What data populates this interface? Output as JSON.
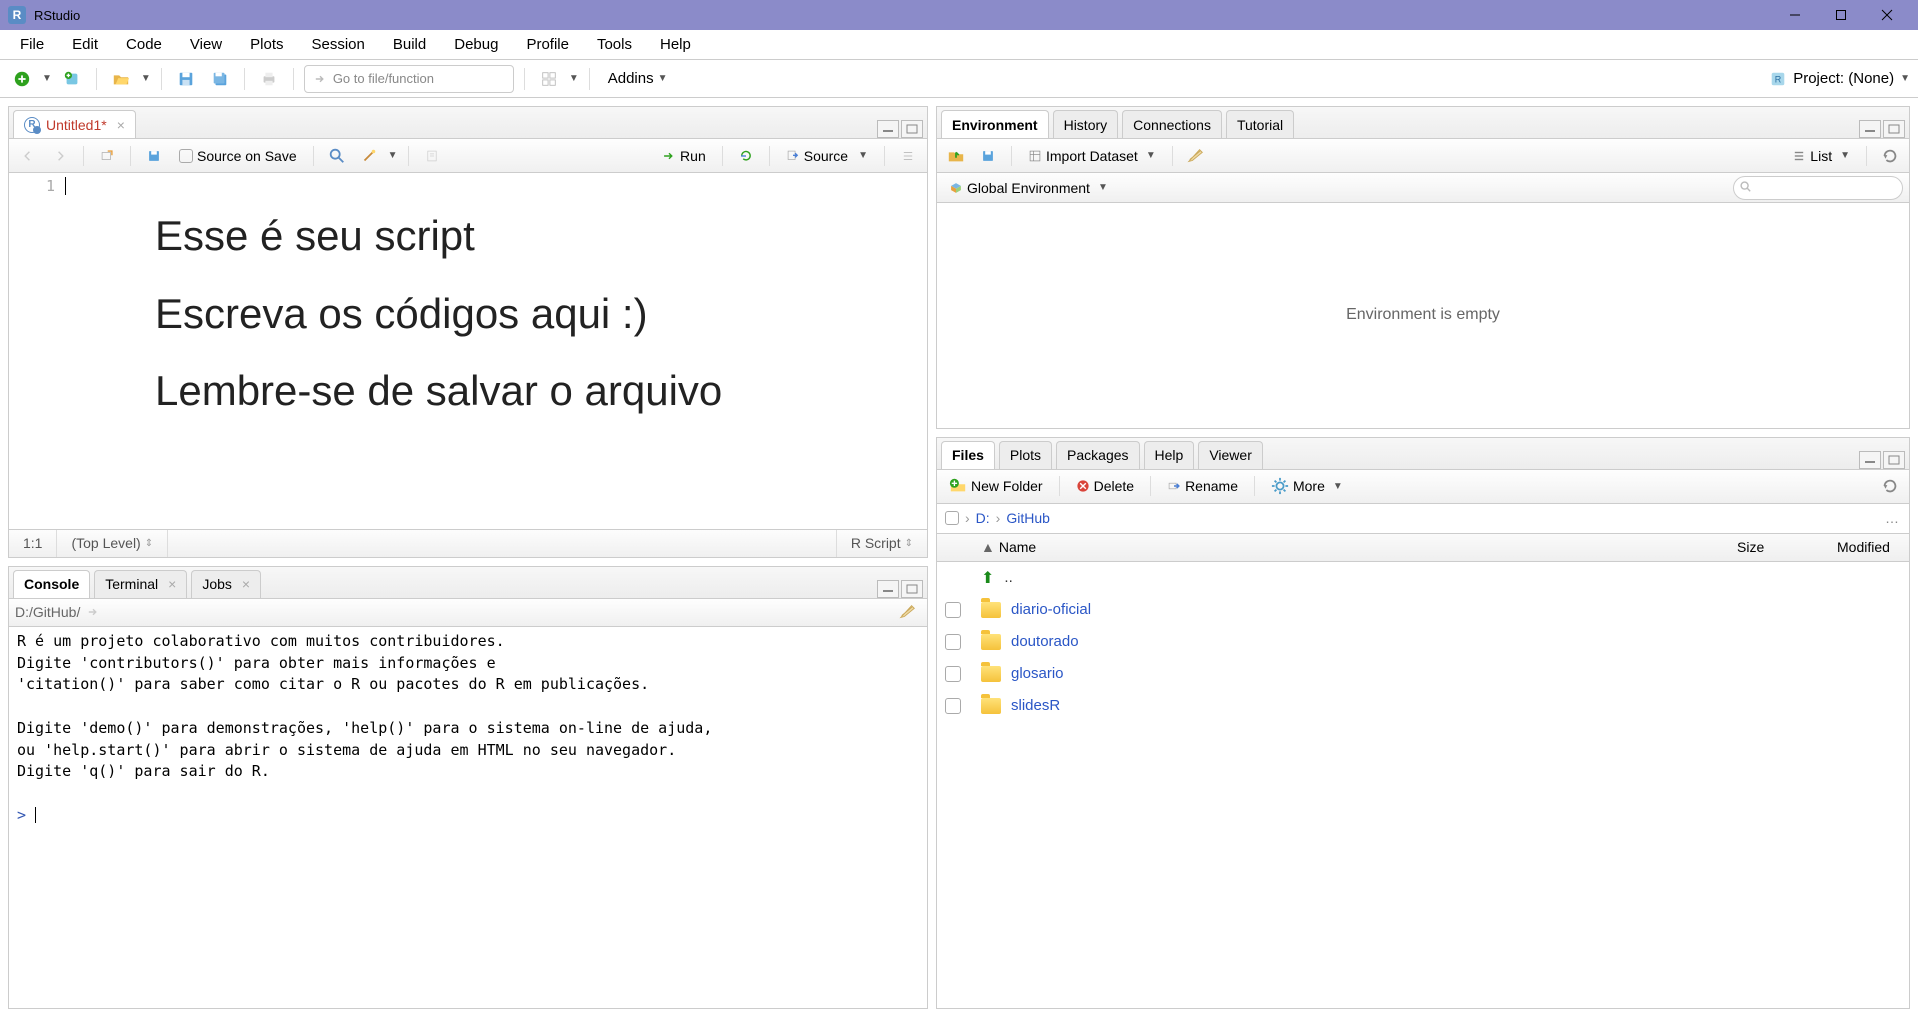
{
  "window": {
    "title": "RStudio"
  },
  "menu": [
    "File",
    "Edit",
    "Code",
    "View",
    "Plots",
    "Session",
    "Build",
    "Debug",
    "Profile",
    "Tools",
    "Help"
  ],
  "mainToolbar": {
    "goto_placeholder": "Go to file/function",
    "addins": "Addins",
    "project": "Project: (None)"
  },
  "sourcePane": {
    "tab_title": "Untitled1*",
    "sourceOnSave": "Source on Save",
    "run": "Run",
    "source": "Source",
    "lineNumber": "1",
    "status_pos": "1:1",
    "status_scope": "(Top Level)",
    "status_lang": "R Script",
    "overlay": {
      "l1": "Esse é seu script",
      "l2": "Escreva os códigos aqui :)",
      "l3": "Lembre-se de salvar o arquivo"
    }
  },
  "consolePane": {
    "tabs": [
      "Console",
      "Terminal",
      "Jobs"
    ],
    "path": "D:/GitHub/",
    "output": "R é um projeto colaborativo com muitos contribuidores.\nDigite 'contributors()' para obter mais informações e\n'citation()' para saber como citar o R ou pacotes do R em publicações.\n\nDigite 'demo()' para demonstrações, 'help()' para o sistema on-line de ajuda,\nou 'help.start()' para abrir o sistema de ajuda em HTML no seu navegador.\nDigite 'q()' para sair do R.\n",
    "prompt": ">"
  },
  "envPane": {
    "tabs": [
      "Environment",
      "History",
      "Connections",
      "Tutorial"
    ],
    "import": "Import Dataset",
    "listLabel": "List",
    "globalEnv": "Global Environment",
    "empty": "Environment is empty"
  },
  "filesPane": {
    "tabs": [
      "Files",
      "Plots",
      "Packages",
      "Help",
      "Viewer"
    ],
    "newFolder": "New Folder",
    "delete": "Delete",
    "rename": "Rename",
    "more": "More",
    "breadcrumb": {
      "drive": "D:",
      "folder": "GitHub"
    },
    "cols": {
      "name": "Name",
      "size": "Size",
      "modified": "Modified"
    },
    "up": "..",
    "items": [
      {
        "name": "diario-oficial"
      },
      {
        "name": "doutorado"
      },
      {
        "name": "glosario"
      },
      {
        "name": "slidesR"
      }
    ]
  }
}
